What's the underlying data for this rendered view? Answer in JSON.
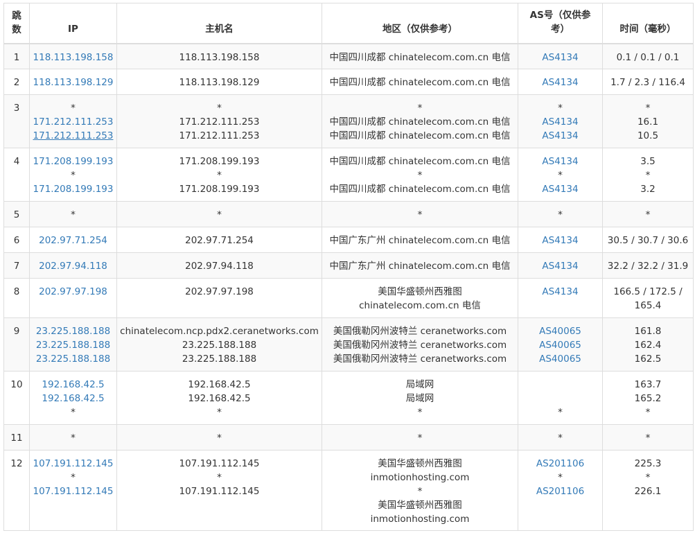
{
  "headers": {
    "hop": "跳数",
    "ip": "IP",
    "host": "主机名",
    "region": "地区（仅供参考）",
    "as": "AS号（仅供参考）",
    "time": "时间（毫秒）"
  },
  "rows": [
    {
      "hop": "1",
      "ip": [
        "118.113.198.158"
      ],
      "host": [
        "118.113.198.158"
      ],
      "region": [
        "中国四川成都 chinatelecom.com.cn 电信"
      ],
      "as": [
        "AS4134"
      ],
      "time": [
        "0.1 / 0.1 / 0.1"
      ]
    },
    {
      "hop": "2",
      "ip": [
        "118.113.198.129"
      ],
      "host": [
        "118.113.198.129"
      ],
      "region": [
        "中国四川成都 chinatelecom.com.cn 电信"
      ],
      "as": [
        "AS4134"
      ],
      "time": [
        "1.7 / 2.3 / 116.4"
      ]
    },
    {
      "hop": "3",
      "ip": [
        "*",
        "171.212.111.253",
        "171.212.111.253"
      ],
      "host": [
        "*",
        "171.212.111.253",
        "171.212.111.253"
      ],
      "region": [
        "*",
        "中国四川成都 chinatelecom.com.cn 电信",
        "中国四川成都 chinatelecom.com.cn 电信"
      ],
      "as": [
        "*",
        "AS4134",
        "AS4134"
      ],
      "time": [
        "*",
        "16.1",
        "10.5"
      ]
    },
    {
      "hop": "4",
      "ip": [
        "171.208.199.193",
        "*",
        "171.208.199.193"
      ],
      "host": [
        "171.208.199.193",
        "*",
        "171.208.199.193"
      ],
      "region": [
        "中国四川成都 chinatelecom.com.cn 电信",
        "*",
        "中国四川成都 chinatelecom.com.cn 电信"
      ],
      "as": [
        "AS4134",
        "*",
        "AS4134"
      ],
      "time": [
        "3.5",
        "*",
        "3.2"
      ]
    },
    {
      "hop": "5",
      "ip": [
        "*"
      ],
      "host": [
        "*"
      ],
      "region": [
        "*"
      ],
      "as": [
        "*"
      ],
      "time": [
        "*"
      ]
    },
    {
      "hop": "6",
      "ip": [
        "202.97.71.254"
      ],
      "host": [
        "202.97.71.254"
      ],
      "region": [
        "中国广东广州 chinatelecom.com.cn 电信"
      ],
      "as": [
        "AS4134"
      ],
      "time": [
        "30.5 / 30.7 / 30.6"
      ]
    },
    {
      "hop": "7",
      "ip": [
        "202.97.94.118"
      ],
      "host": [
        "202.97.94.118"
      ],
      "region": [
        "中国广东广州 chinatelecom.com.cn 电信"
      ],
      "as": [
        "AS4134"
      ],
      "time": [
        "32.2 / 32.2 / 31.9"
      ]
    },
    {
      "hop": "8",
      "ip": [
        "202.97.97.198"
      ],
      "host": [
        "202.97.97.198"
      ],
      "region": [
        "美国华盛顿州西雅图",
        "chinatelecom.com.cn 电信"
      ],
      "as": [
        "AS4134"
      ],
      "time": [
        "166.5 / 172.5 /",
        "165.4"
      ]
    },
    {
      "hop": "9",
      "ip": [
        "23.225.188.188",
        "23.225.188.188",
        "23.225.188.188"
      ],
      "host": [
        "chinatelecom.ncp.pdx2.ceranetworks.com",
        "23.225.188.188",
        "23.225.188.188"
      ],
      "region": [
        "美国俄勒冈州波特兰 ceranetworks.com",
        "美国俄勒冈州波特兰 ceranetworks.com",
        "美国俄勒冈州波特兰 ceranetworks.com"
      ],
      "as": [
        "AS40065",
        "AS40065",
        "AS40065"
      ],
      "time": [
        "161.8",
        "162.4",
        "162.5"
      ]
    },
    {
      "hop": "10",
      "ip": [
        "192.168.42.5",
        "192.168.42.5",
        "*"
      ],
      "host": [
        "192.168.42.5",
        "192.168.42.5",
        "*"
      ],
      "region": [
        "局域网",
        "局域网",
        "*"
      ],
      "as": [
        "",
        "",
        "*"
      ],
      "time": [
        "163.7",
        "165.2",
        "*"
      ]
    },
    {
      "hop": "11",
      "ip": [
        "*"
      ],
      "host": [
        "*"
      ],
      "region": [
        "*"
      ],
      "as": [
        "*"
      ],
      "time": [
        "*"
      ]
    },
    {
      "hop": "12",
      "ip": [
        "107.191.112.145",
        "*",
        "107.191.112.145"
      ],
      "host": [
        "107.191.112.145",
        "*",
        "107.191.112.145"
      ],
      "region": [
        "美国华盛顿州西雅图",
        "inmotionhosting.com",
        "*",
        "美国华盛顿州西雅图",
        "inmotionhosting.com"
      ],
      "as": [
        "AS201106",
        "*",
        "AS201106"
      ],
      "time": [
        "225.3",
        "*",
        "226.1"
      ]
    }
  ]
}
